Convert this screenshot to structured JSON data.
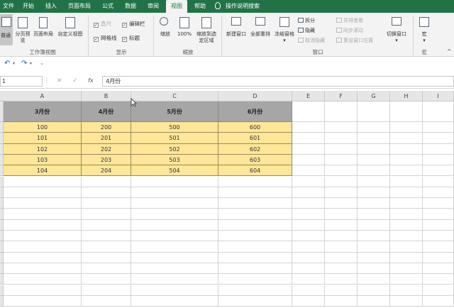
{
  "tabs": [
    "文件",
    "开始",
    "插入",
    "页面布局",
    "公式",
    "数据",
    "审阅",
    "视图",
    "帮助",
    "操作说明搜索"
  ],
  "ribbon": {
    "workbook_views": {
      "label": "工作簿视图",
      "buttons": [
        "普通",
        "分页预览",
        "页面布局",
        "自定义视图"
      ]
    },
    "show": {
      "label": "显示",
      "items": [
        {
          "text": "直尺",
          "checked": true,
          "disabled": true
        },
        {
          "text": "网格线",
          "checked": true
        },
        {
          "text": "编辑栏",
          "checked": true
        },
        {
          "text": "标题",
          "checked": true
        }
      ]
    },
    "zoom": {
      "label": "缩放",
      "buttons": [
        "缩放",
        "100%",
        "缩放到选定区域"
      ]
    },
    "window": {
      "label": "窗口",
      "buttons": [
        "新建窗口",
        "全部重排",
        "冻结窗格"
      ],
      "small": [
        "拆分",
        "隐藏",
        "取消隐藏",
        "并排查看",
        "同步滚动",
        "重设窗口位置"
      ],
      "switch": "切换窗口"
    },
    "macros": {
      "label": "宏",
      "button": "宏"
    }
  },
  "formula_bar": {
    "name_box": "1",
    "fx": "fx",
    "value": "4月份"
  },
  "columns": [
    "A",
    "B",
    "C",
    "D",
    "E",
    "F",
    "G",
    "H",
    "I"
  ],
  "table": {
    "headers": [
      "3月份",
      "4月份",
      "5月份",
      "6月份"
    ],
    "rows": [
      [
        "100",
        "200",
        "500",
        "600"
      ],
      [
        "101",
        "201",
        "501",
        "601"
      ],
      [
        "102",
        "202",
        "502",
        "602"
      ],
      [
        "103",
        "203",
        "503",
        "603"
      ],
      [
        "104",
        "204",
        "504",
        "604"
      ]
    ]
  },
  "colors": {
    "accent": "#217346",
    "header_fill": "#a6a6a6",
    "data_fill": "#ffe699"
  }
}
